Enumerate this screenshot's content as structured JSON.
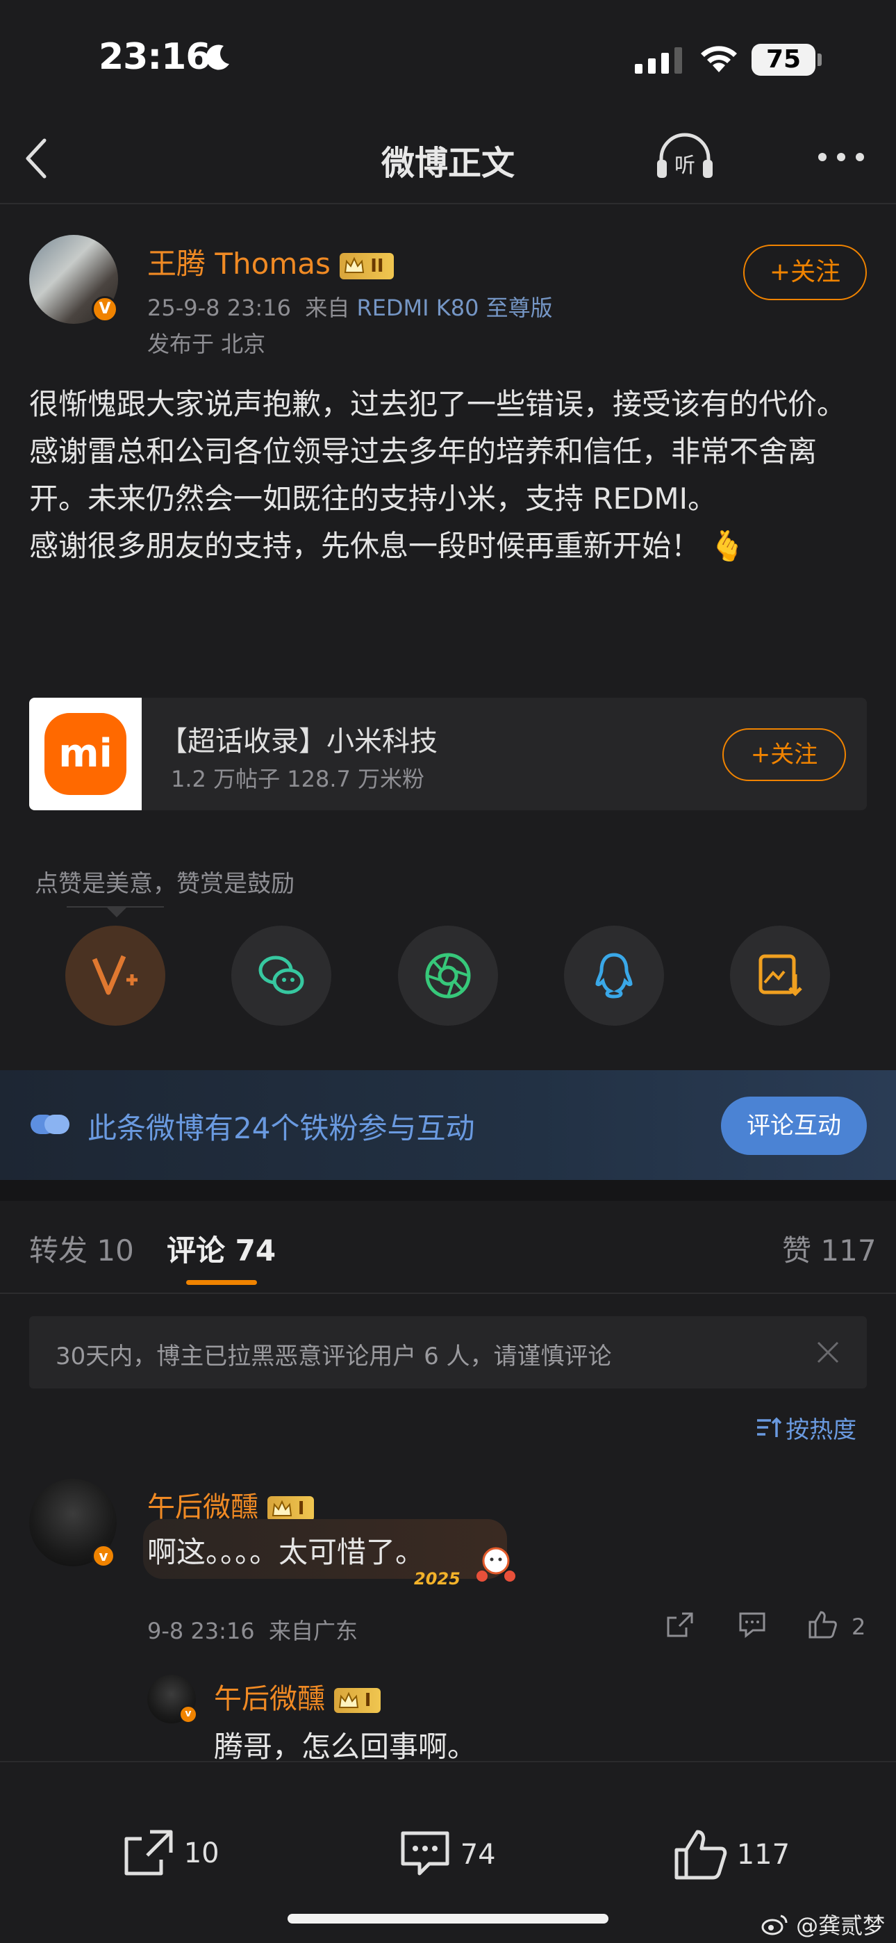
{
  "status_bar": {
    "time": "23:16",
    "battery": "75"
  },
  "nav": {
    "title": "微博正文"
  },
  "post": {
    "author": "王腾 Thomas",
    "level": "II",
    "verified": "V",
    "date": "25-9-8 23:16",
    "source_prefix": "来自",
    "source_device": "REDMI K80 至尊版",
    "location": "发布于 北京",
    "follow_label": "+关注",
    "paragraphs": [
      "很惭愧跟大家说声抱歉，过去犯了一些错误，接受该有的代价。",
      "感谢雷总和公司各位领导过去多年的培养和信任，非常不舍离开。未来仍然会一如既往的支持小米，支持 REDMI。",
      "",
      "感谢很多朋友的支持，先休息一段时候再重新开始！ 🫰"
    ]
  },
  "topic_card": {
    "logo_text": "mi",
    "title": "【超话收录】小米科技",
    "subtitle": "1.2 万帖子  128.7 万米粉",
    "follow_label": "+关注"
  },
  "reward": {
    "tip": "点赞是美意，赞赏是鼓励"
  },
  "share_icons": [
    "reward-v-plus-icon",
    "wechat-icon",
    "moments-icon",
    "qq-icon",
    "save-image-icon"
  ],
  "fans_banner": {
    "text": "此条微博有24个铁粉参与互动",
    "button": "评论互动"
  },
  "tabs": {
    "repost_label": "转发",
    "repost_count": "10",
    "comment_label": "评论",
    "comment_count": "74",
    "like_label": "赞",
    "like_count": "117"
  },
  "notice": {
    "text": "30天内，博主已拉黑恶意评论用户 6 人，请谨慎评论"
  },
  "sort_label": "按热度",
  "comments": [
    {
      "user": "午后微醺",
      "level": "I",
      "text": "啊这。。。。太可惜了。",
      "sticker": "2025",
      "time": "9-8 23:16",
      "source": "来自广东",
      "likes": "2"
    },
    {
      "user": "午后微醺",
      "level": "I",
      "text": "腾哥，怎么回事啊。"
    }
  ],
  "bottom_bar": {
    "repost": "10",
    "comment": "74",
    "like": "117"
  },
  "watermark": "@龚贰梦",
  "colors": {
    "accent": "#f08300",
    "link": "#6a9ae0",
    "background": "#1c1c1e"
  }
}
